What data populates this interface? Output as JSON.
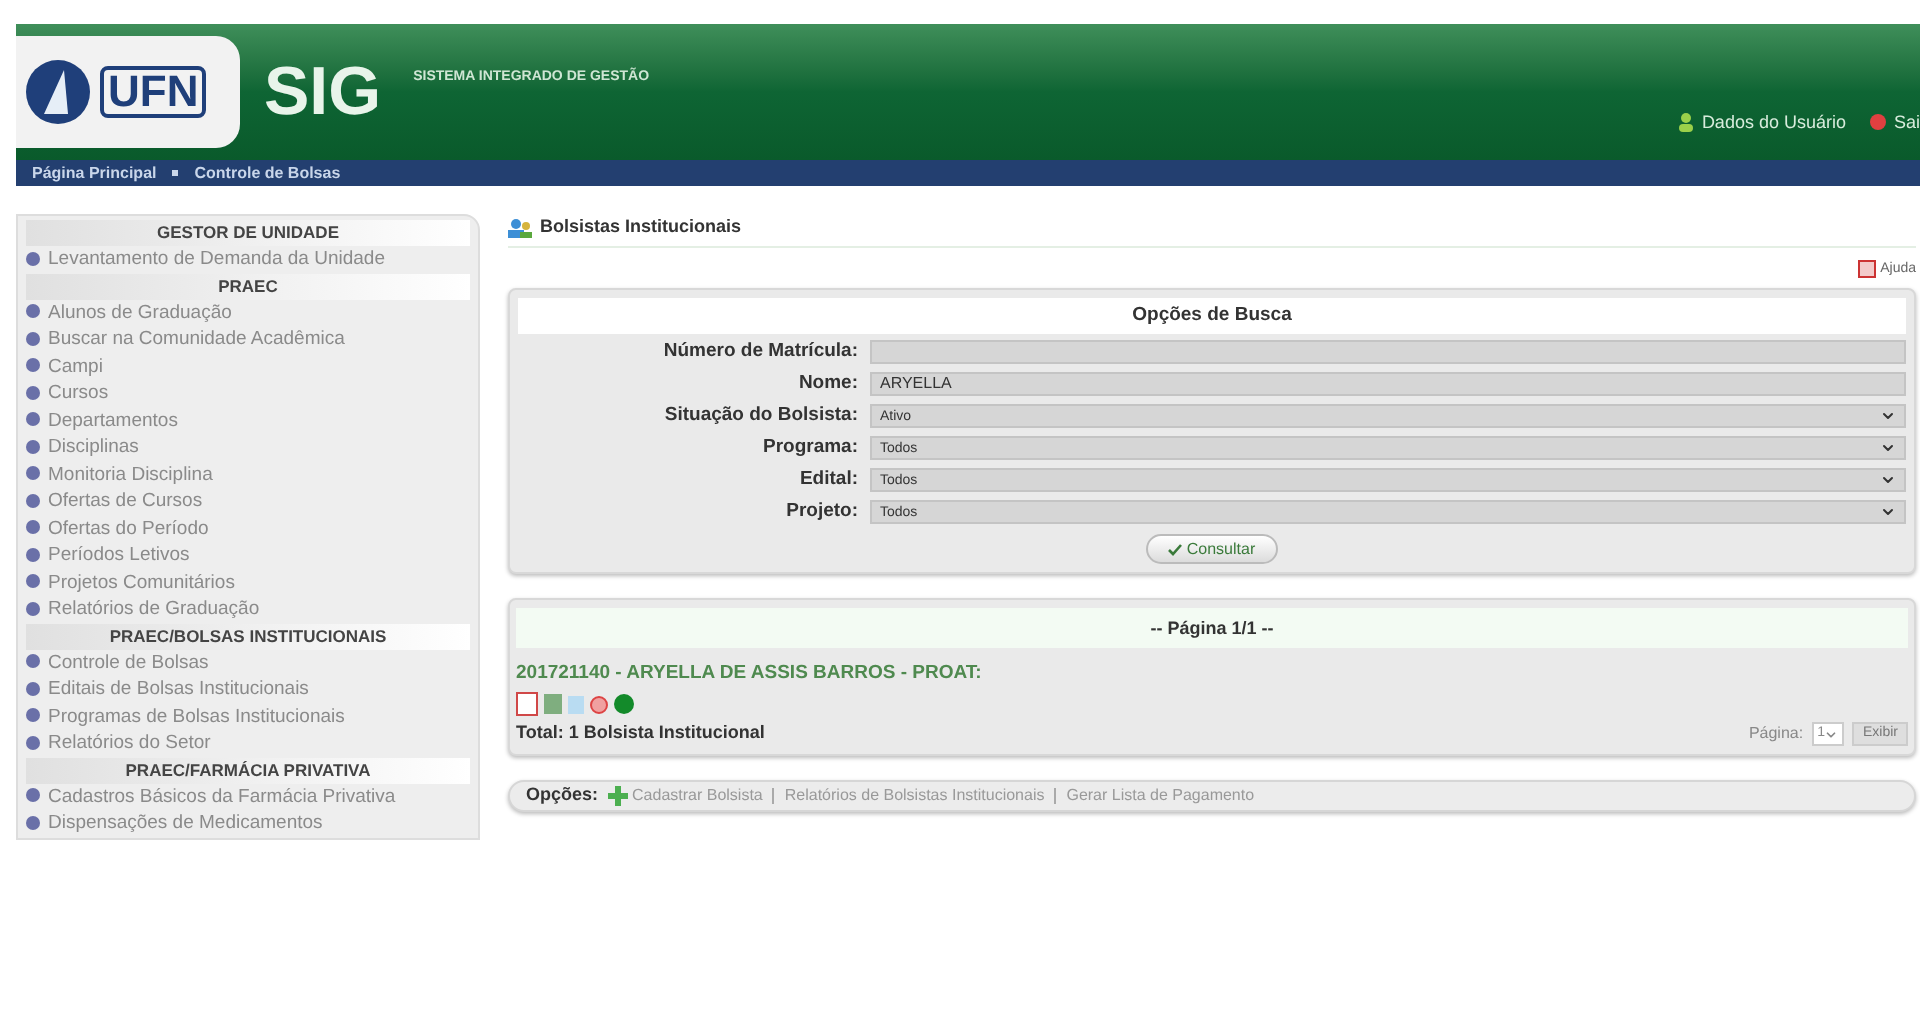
{
  "header": {
    "logo_text": "UFN",
    "app_name": "SIG",
    "app_subtitle": "SISTEMA INTEGRADO DE GESTÃO",
    "user_link": "Dados do Usuário",
    "exit_link": "Sai"
  },
  "breadcrumb": [
    "Página Principal",
    "Controle de Bolsas"
  ],
  "sidebar": [
    {
      "title": "GESTOR DE UNIDADE",
      "items": [
        "Levantamento de Demanda da Unidade"
      ]
    },
    {
      "title": "PRAEC",
      "items": [
        "Alunos de Graduação",
        "Buscar na Comunidade Acadêmica",
        "Campi",
        "Cursos",
        "Departamentos",
        "Disciplinas",
        "Monitoria Disciplina",
        "Ofertas de Cursos",
        "Ofertas do Período",
        "Períodos Letivos",
        "Projetos Comunitários",
        "Relatórios de Graduação"
      ]
    },
    {
      "title": "PRAEC/BOLSAS INSTITUCIONAIS",
      "items": [
        "Controle de Bolsas",
        "Editais de Bolsas Institucionais",
        "Programas de Bolsas Institucionais",
        "Relatórios do Setor"
      ]
    },
    {
      "title": "PRAEC/FARMÁCIA PRIVATIVA",
      "items": [
        "Cadastros Básicos da Farmácia Privativa",
        "Dispensações de Medicamentos"
      ]
    }
  ],
  "page_title": "Bolsistas Institucionais",
  "help_link": "Ajuda",
  "search": {
    "title": "Opções de Busca",
    "fields": [
      {
        "label": "Número de Matrícula:",
        "kind": "text"
      },
      {
        "label": "Nome:",
        "kind": "text",
        "value": "ARYELLA"
      },
      {
        "label": "Situação do Bolsista:",
        "kind": "select",
        "value": "Ativo"
      },
      {
        "label": "Programa:",
        "kind": "select",
        "value": "Todos"
      },
      {
        "label": "Edital:",
        "kind": "select",
        "value": "Todos"
      },
      {
        "label": "Projeto:",
        "kind": "select",
        "value": "Todos"
      }
    ],
    "button": "Consultar"
  },
  "results": {
    "pager_title": "-- Página 1/1 --",
    "rows": [
      "201721140 - ARYELLA DE ASSIS BARROS - PROAT:"
    ],
    "total": "Total: 1 Bolsista Institucional",
    "page_label": "Página:",
    "page_value": "1",
    "page_button": "Exibir"
  },
  "options": {
    "label": "Opções:",
    "links": [
      "Cadastrar Bolsista",
      "Relatórios de Bolsistas Institucionais",
      "Gerar Lista de Pagamento"
    ]
  }
}
